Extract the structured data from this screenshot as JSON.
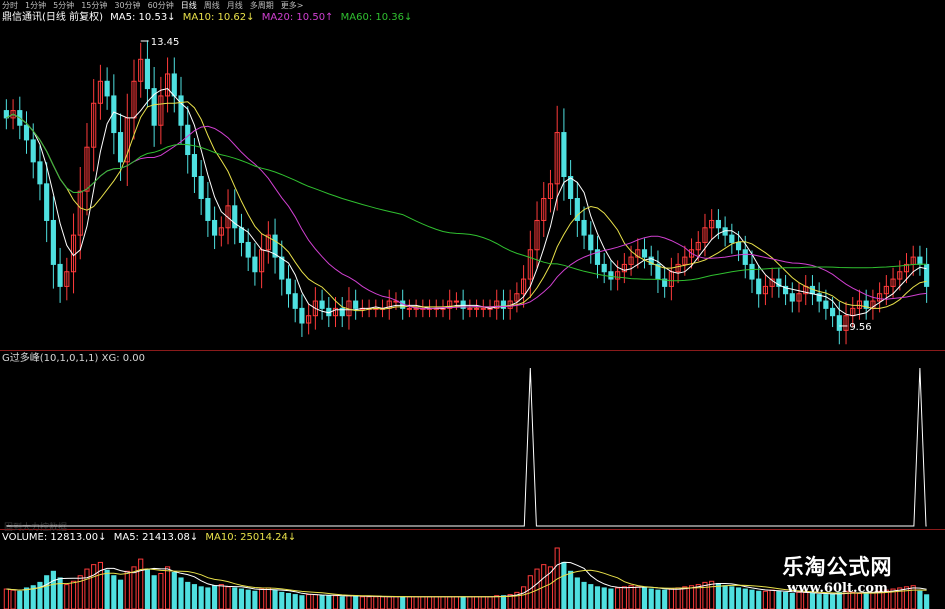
{
  "periods": [
    "分时",
    "1分钟",
    "5分钟",
    "15分钟",
    "30分钟",
    "60分钟",
    "日线",
    "周线",
    "月线",
    "多周期",
    "更多>"
  ],
  "active_period": "日线",
  "main_header": {
    "stock": "鼎信通讯(日线 前复权)",
    "ma5": "MA5: 10.53↓",
    "ma10": "MA10: 10.62↓",
    "ma20": "MA20: 10.50↑",
    "ma60": "MA60: 10.36↓"
  },
  "indicator_header": {
    "text": "G过多峰(10,1,0,1,1) XG: 0.00"
  },
  "volume_header": {
    "vol": "VOLUME: 12813.00↓",
    "ma5": "MA5: 21413.08↓",
    "ma10": "MA10: 25014.24↓"
  },
  "faint_text": "固到大力控数据",
  "annotations": {
    "high": "13.45",
    "low": "9.56"
  },
  "watermark": {
    "title": "乐淘公式网",
    "url": "www.60lt.com"
  },
  "colors": {
    "up": "#ff3b3b",
    "down": "#4fe0e0",
    "ma5": "#ffffff",
    "ma10": "#e8e04a",
    "ma20": "#d040d0",
    "ma60": "#30c030",
    "xg": "#ffffff",
    "grid": "#8a1b1b"
  },
  "chart_data": [
    {
      "type": "candlestick",
      "title": "鼎信通讯(日线 前复权)",
      "closes": [
        12.4,
        12.5,
        12.3,
        12.1,
        11.8,
        11.5,
        11.0,
        10.4,
        10.1,
        10.3,
        10.8,
        11.4,
        12.0,
        12.6,
        12.9,
        12.7,
        12.2,
        11.8,
        12.4,
        12.9,
        13.2,
        12.8,
        12.3,
        12.7,
        13.0,
        12.7,
        12.3,
        11.9,
        11.6,
        11.3,
        11.0,
        10.8,
        10.9,
        11.2,
        10.9,
        10.7,
        10.5,
        10.3,
        10.6,
        10.8,
        10.5,
        10.2,
        10.0,
        9.8,
        9.6,
        9.7,
        9.9,
        9.8,
        9.7,
        9.8,
        9.7,
        9.9,
        9.8,
        9.8,
        9.8,
        9.8,
        9.8,
        9.9,
        9.9,
        9.8,
        9.8,
        9.8,
        9.8,
        9.8,
        9.8,
        9.8,
        9.9,
        9.9,
        9.8,
        9.8,
        9.8,
        9.8,
        9.8,
        9.9,
        9.8,
        9.9,
        10.0,
        10.2,
        10.6,
        11.0,
        11.3,
        11.5,
        12.2,
        11.6,
        11.3,
        11.0,
        10.8,
        10.6,
        10.4,
        10.3,
        10.2,
        10.3,
        10.4,
        10.5,
        10.6,
        10.5,
        10.4,
        10.2,
        10.1,
        10.3,
        10.4,
        10.5,
        10.6,
        10.7,
        10.9,
        11.0,
        10.9,
        10.8,
        10.7,
        10.6,
        10.4,
        10.2,
        10.0,
        10.1,
        10.2,
        10.1,
        10.0,
        9.9,
        10.0,
        10.1,
        10.0,
        9.9,
        9.8,
        9.7,
        9.5,
        9.7,
        9.8,
        9.9,
        9.8,
        9.9,
        10.0,
        10.1,
        10.2,
        10.3,
        10.4,
        10.5,
        10.4,
        10.1
      ],
      "ma5": "10.53",
      "ma10": "10.62",
      "ma20": "10.50",
      "ma60": "10.36",
      "high": 13.45,
      "low": 9.56,
      "ylim": [
        9.3,
        13.6
      ]
    },
    {
      "type": "line",
      "title": "G过多峰(10,1,0,1,1)",
      "series": [
        {
          "name": "XG",
          "peaks_at_index": [
            78,
            136
          ],
          "value": "0.00"
        }
      ],
      "ylim": [
        0,
        1
      ]
    },
    {
      "type": "bar",
      "title": "VOLUME",
      "values": [
        18000,
        17000,
        16000,
        19000,
        21000,
        24000,
        30000,
        34000,
        28000,
        22000,
        25000,
        30000,
        36000,
        40000,
        42000,
        35000,
        30000,
        26000,
        34000,
        38000,
        45000,
        36000,
        30000,
        32000,
        38000,
        33000,
        28000,
        24000,
        22000,
        20000,
        19000,
        21000,
        22000,
        20000,
        19000,
        18000,
        17000,
        16000,
        18000,
        19000,
        17000,
        15000,
        14000,
        13000,
        12000,
        13000,
        13000,
        12000,
        12000,
        12000,
        11000,
        12000,
        12000,
        11000,
        11000,
        11000,
        11000,
        11000,
        11000,
        11000,
        11000,
        11000,
        11000,
        11000,
        11000,
        11000,
        11000,
        11000,
        11000,
        11000,
        11000,
        11000,
        11000,
        12000,
        12000,
        13000,
        15000,
        20000,
        30000,
        36000,
        40000,
        38000,
        55000,
        42000,
        34000,
        28000,
        24000,
        22000,
        20000,
        19000,
        18000,
        19000,
        20000,
        21000,
        20000,
        19000,
        18000,
        17000,
        17000,
        18000,
        19000,
        20000,
        21000,
        22000,
        24000,
        25000,
        23000,
        21000,
        20000,
        19000,
        18000,
        17000,
        16000,
        16000,
        17000,
        16000,
        15000,
        14000,
        15000,
        15000,
        14000,
        13000,
        13000,
        13000,
        15000,
        16000,
        15000,
        14000,
        15000,
        15000,
        16000,
        17000,
        18000,
        19000,
        20000,
        21000,
        16000,
        12813
      ],
      "ma5": "21413.08",
      "ma10": "25014.24"
    }
  ]
}
